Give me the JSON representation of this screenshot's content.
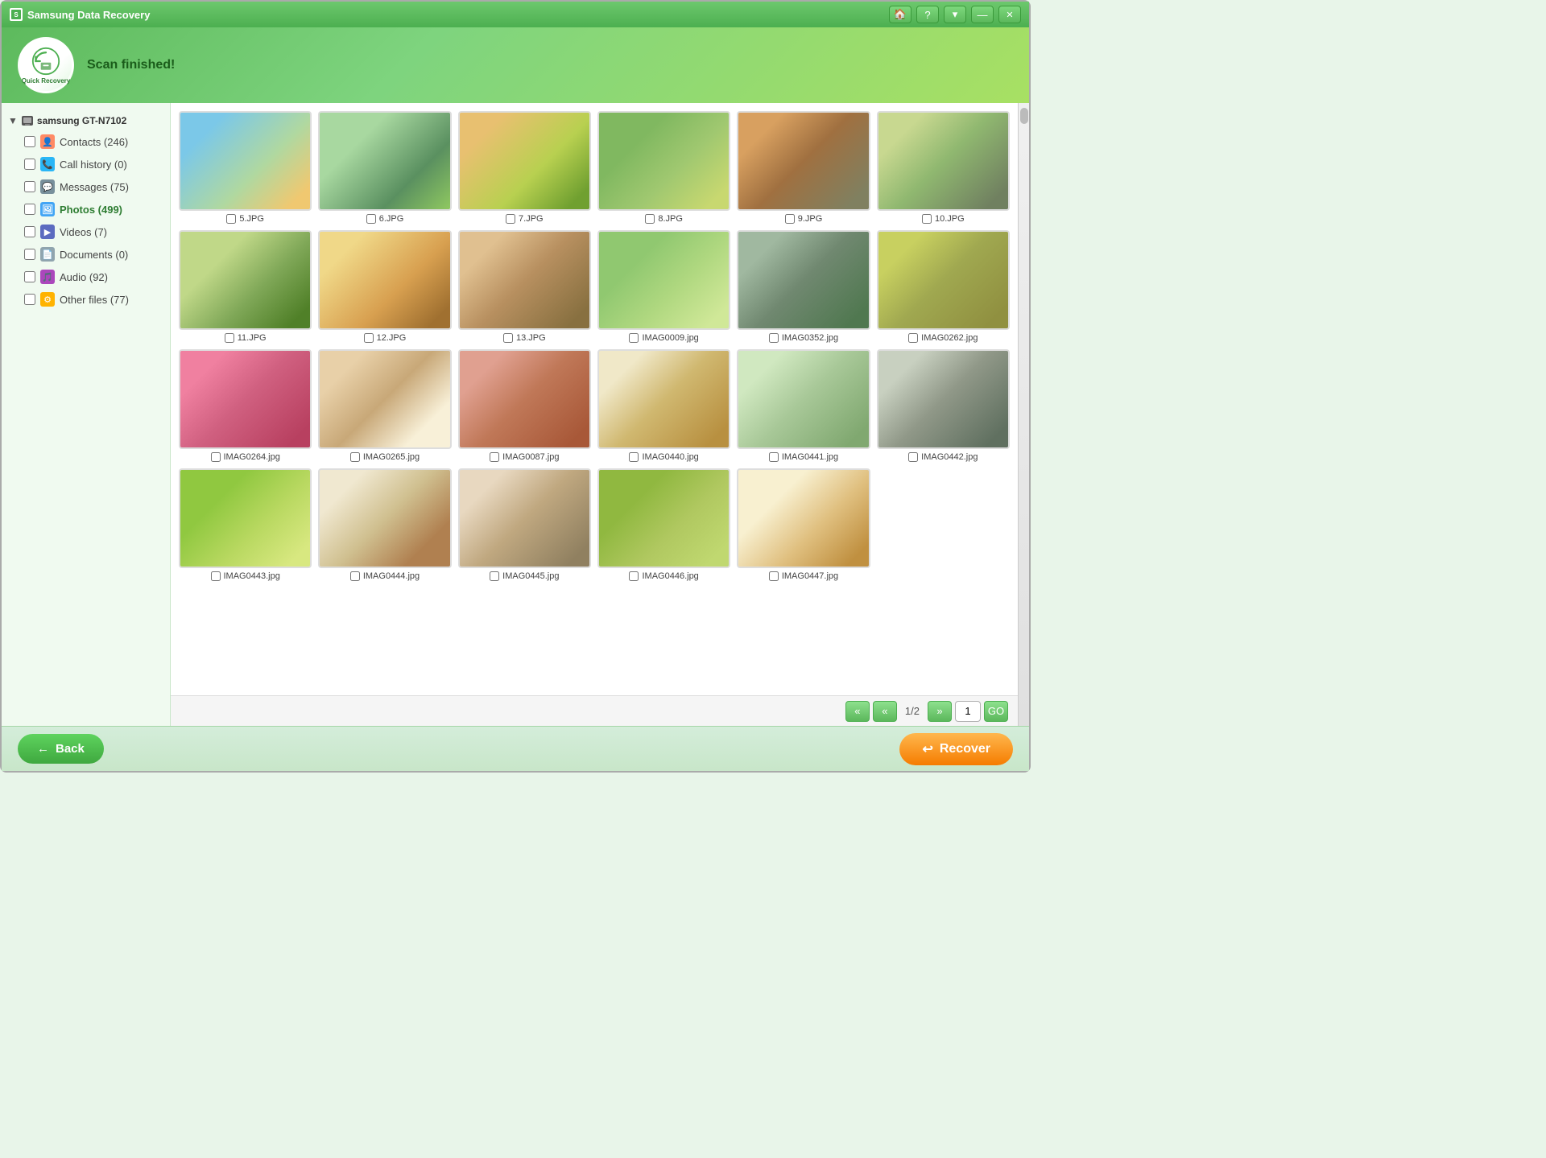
{
  "app": {
    "title": "Samsung Data Recovery",
    "window_controls": [
      "home",
      "help",
      "dropdown",
      "minimize",
      "close"
    ]
  },
  "header": {
    "logo_label": "Quick Recovery",
    "scan_status": "Scan finished!"
  },
  "sidebar": {
    "device": "samsung GT-N7102",
    "items": [
      {
        "id": "contacts",
        "label": "Contacts (246)",
        "icon": "contacts",
        "checked": false
      },
      {
        "id": "call-history",
        "label": "Call history (0)",
        "icon": "calls",
        "checked": false
      },
      {
        "id": "messages",
        "label": "Messages (75)",
        "icon": "messages",
        "checked": false
      },
      {
        "id": "photos",
        "label": "Photos (499)",
        "icon": "photos",
        "checked": false,
        "active": true
      },
      {
        "id": "videos",
        "label": "Videos (7)",
        "icon": "videos",
        "checked": false
      },
      {
        "id": "documents",
        "label": "Documents (0)",
        "icon": "documents",
        "checked": false
      },
      {
        "id": "audio",
        "label": "Audio (92)",
        "icon": "audio",
        "checked": false
      },
      {
        "id": "other-files",
        "label": "Other files (77)",
        "icon": "other",
        "checked": false
      }
    ]
  },
  "photos": {
    "items": [
      {
        "name": "5.JPG",
        "img_class": "img-1"
      },
      {
        "name": "6.JPG",
        "img_class": "img-2"
      },
      {
        "name": "7.JPG",
        "img_class": "img-3"
      },
      {
        "name": "8.JPG",
        "img_class": "img-4"
      },
      {
        "name": "9.JPG",
        "img_class": "img-5"
      },
      {
        "name": "10.JPG",
        "img_class": "img-6"
      },
      {
        "name": "11.JPG",
        "img_class": "img-7"
      },
      {
        "name": "12.JPG",
        "img_class": "img-8"
      },
      {
        "name": "13.JPG",
        "img_class": "img-9"
      },
      {
        "name": "IMAG0009.jpg",
        "img_class": "img-10"
      },
      {
        "name": "IMAG0352.jpg",
        "img_class": "img-11"
      },
      {
        "name": "IMAG0262.jpg",
        "img_class": "img-12"
      },
      {
        "name": "IMAG0264.jpg",
        "img_class": "img-13"
      },
      {
        "name": "IMAG0265.jpg",
        "img_class": "img-14"
      },
      {
        "name": "IMAG0087.jpg",
        "img_class": "img-15"
      },
      {
        "name": "IMAG0440.jpg",
        "img_class": "img-16"
      },
      {
        "name": "IMAG0441.jpg",
        "img_class": "img-17"
      },
      {
        "name": "IMAG0442.jpg",
        "img_class": "img-18"
      },
      {
        "name": "IMAG0443.jpg",
        "img_class": "img-19"
      },
      {
        "name": "IMAG0444.jpg",
        "img_class": "img-20"
      },
      {
        "name": "IMAG0445.jpg",
        "img_class": "img-21"
      },
      {
        "name": "IMAG0446.jpg",
        "img_class": "img-22"
      },
      {
        "name": "IMAG0447.jpg",
        "img_class": "img-23"
      }
    ]
  },
  "pagination": {
    "first_label": "«",
    "prev_label": "«",
    "current_page": "1/2",
    "next_label": "»",
    "page_input_value": "1",
    "go_label": "GO"
  },
  "bottom_bar": {
    "back_label": "Back",
    "recover_label": "Recover"
  }
}
